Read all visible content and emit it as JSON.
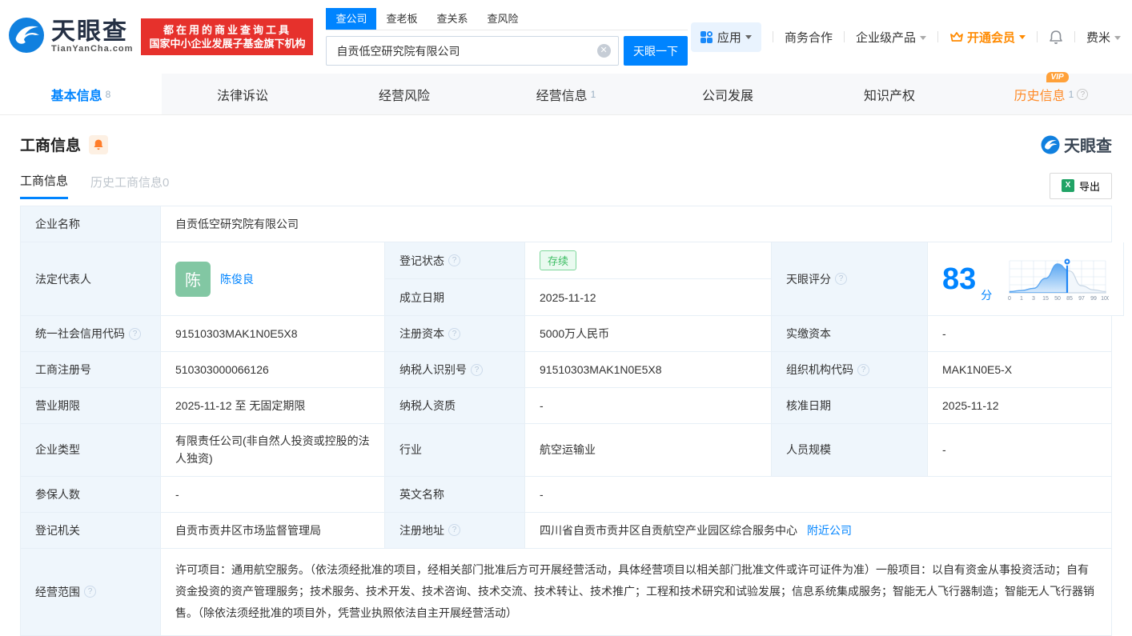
{
  "header": {
    "logo": {
      "name": "天眼查",
      "domain": "TianYanCha.com"
    },
    "slogan": {
      "line1": "都在用的商业查询工具",
      "line2": "国家中小企业发展子基金旗下机构"
    },
    "search": {
      "tabs": [
        {
          "label": "查公司",
          "active": true
        },
        {
          "label": "查老板",
          "active": false
        },
        {
          "label": "查关系",
          "active": false
        },
        {
          "label": "查风险",
          "active": false
        }
      ],
      "value": "自贡低空研究院有限公司",
      "button": "天眼一下"
    },
    "nav": {
      "apps": "应用",
      "cooperation": "商务合作",
      "enterprise": "企业级产品",
      "vip": "开通会员",
      "user": "费米"
    }
  },
  "tabbar": {
    "tabs": [
      {
        "label": "基本信息",
        "count": "8",
        "active": true
      },
      {
        "label": "法律诉讼"
      },
      {
        "label": "经营风险"
      },
      {
        "label": "经营信息",
        "count": "1"
      },
      {
        "label": "公司发展"
      },
      {
        "label": "知识产权"
      },
      {
        "label": "历史信息",
        "count": "1",
        "vip": "VIP"
      }
    ]
  },
  "section": {
    "title": "工商信息",
    "watermark": "天眼查",
    "subtabs": [
      {
        "label": "工商信息",
        "active": true
      },
      {
        "label": "历史工商信息0",
        "active": false
      }
    ],
    "export_label": "导出"
  },
  "table": {
    "company_name": {
      "label": "企业名称",
      "value": "自贡低空研究院有限公司"
    },
    "legal_rep": {
      "label": "法定代表人",
      "avatar": "陈",
      "name": "陈俊良"
    },
    "reg_status": {
      "label": "登记状态",
      "value": "存续"
    },
    "establish_date": {
      "label": "成立日期",
      "value": "2025-11-12"
    },
    "tyc_score": {
      "label": "天眼评分",
      "score": "83",
      "unit": "分"
    },
    "credit_code": {
      "label": "统一社会信用代码",
      "value": "91510303MAK1N0E5X8"
    },
    "reg_capital": {
      "label": "注册资本",
      "value": "5000万人民币"
    },
    "paid_capital": {
      "label": "实缴资本",
      "value": "-"
    },
    "reg_number": {
      "label": "工商注册号",
      "value": "510303000066126"
    },
    "taxpayer_id": {
      "label": "纳税人识别号",
      "value": "91510303MAK1N0E5X8"
    },
    "org_code": {
      "label": "组织机构代码",
      "value": "MAK1N0E5-X"
    },
    "business_term": {
      "label": "营业期限",
      "value": "2025-11-12 至 无固定期限"
    },
    "taxpayer_quality": {
      "label": "纳税人资质",
      "value": "-"
    },
    "approval_date": {
      "label": "核准日期",
      "value": "2025-11-12"
    },
    "company_type": {
      "label": "企业类型",
      "value": "有限责任公司(非自然人投资或控股的法人独资)"
    },
    "industry": {
      "label": "行业",
      "value": "航空运输业"
    },
    "staff_size": {
      "label": "人员规模",
      "value": "-"
    },
    "insured_count": {
      "label": "参保人数",
      "value": "-"
    },
    "english_name": {
      "label": "英文名称",
      "value": "-"
    },
    "reg_authority": {
      "label": "登记机关",
      "value": "自贡市贡井区市场监督管理局"
    },
    "reg_address": {
      "label": "注册地址",
      "value": "四川省自贡市贡井区自贡航空产业园区综合服务中心",
      "link": "附近公司"
    },
    "business_scope": {
      "label": "经营范围",
      "value": "许可项目：通用航空服务。（依法须经批准的项目，经相关部门批准后方可开展经营活动，具体经营项目以相关部门批准文件或许可证件为准）一般项目：以自有资金从事投资活动；自有资金投资的资产管理服务；技术服务、技术开发、技术咨询、技术交流、技术转让、技术推广；工程和技术研究和试验发展；信息系统集成服务；智能无人飞行器制造；智能无人飞行器销售。（除依法须经批准的项目外，凭营业执照依法自主开展经营活动）"
    }
  },
  "chart_data": {
    "type": "area",
    "title": "天眼评分分布曲线",
    "score": 83,
    "x_ticks": [
      "0",
      "1",
      "3",
      "15",
      "50",
      "85",
      "97",
      "99",
      "100"
    ],
    "curve_y_pct": [
      4,
      7,
      14,
      45,
      90,
      68,
      22,
      9,
      4
    ],
    "marker_x_pct": 60,
    "grid": true,
    "colors": {
      "area": "#5ba7f2",
      "area_light": "#d9ebfc",
      "tail": "#c7d5e4",
      "grid": "#e2ebf5",
      "marker": "#1f86f5",
      "tick": "#7d8da0"
    }
  }
}
